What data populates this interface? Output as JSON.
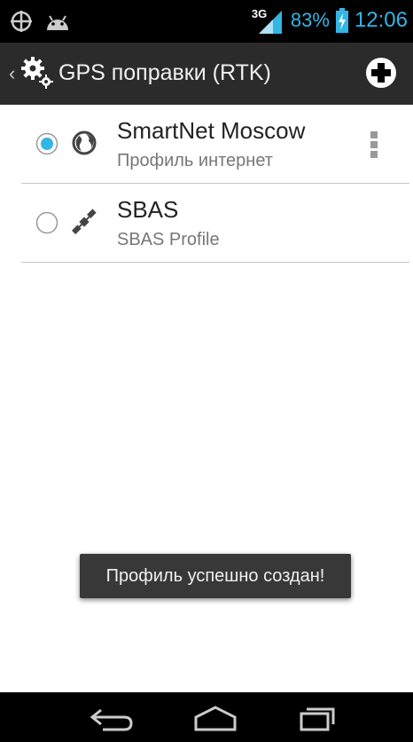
{
  "status_bar": {
    "network": "3G",
    "battery": "83%",
    "time": "12:06",
    "left_icons": [
      "gps-icon",
      "android-icon"
    ]
  },
  "action_bar": {
    "title": "GPS поправки (RTK)",
    "add_icon": "add-icon"
  },
  "profiles": [
    {
      "name": "SmartNet Moscow",
      "subtitle": "Профиль интернет",
      "selected": true,
      "icon": "globe-icon"
    },
    {
      "name": "SBAS",
      "subtitle": "SBAS Profile",
      "selected": false,
      "icon": "satellite-icon"
    }
  ],
  "toast": {
    "message": "Профиль успешно создан!"
  },
  "colors": {
    "accent": "#33b5e5",
    "actionbar": "#2b2b2b",
    "divider": "#c8c8c8"
  }
}
